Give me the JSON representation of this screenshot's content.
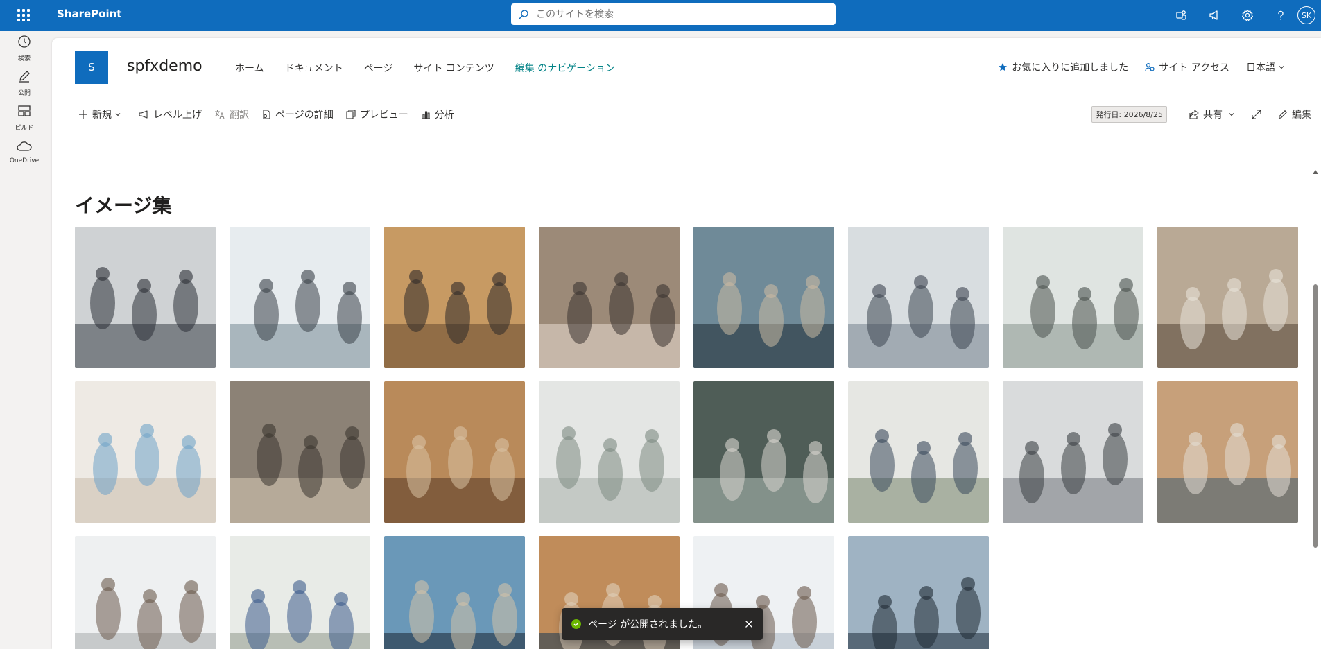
{
  "suite_bar": {
    "app_name": "SharePoint",
    "search_placeholder": "このサイトを検索",
    "user_initials": "SK",
    "icons": [
      "waffle-icon",
      "teams-icon",
      "megaphone-icon",
      "gear-icon",
      "help-icon"
    ]
  },
  "app_bar": {
    "items": [
      {
        "label": "検索",
        "icon": "search-icon"
      },
      {
        "label": "公開",
        "icon": "pen-icon"
      },
      {
        "label": "ビルド",
        "icon": "build-icon"
      },
      {
        "label": "OneDrive",
        "icon": "cloud-icon"
      }
    ]
  },
  "site": {
    "logo_letter": "S",
    "title": "spfxdemo",
    "nav": [
      "ホーム",
      "ドキュメント",
      "ページ",
      "サイト コンテンツ",
      "編集 のナビゲーション"
    ],
    "favorite": "お気に入りに追加しました",
    "site_access": "サイト アクセス",
    "language": "日本語"
  },
  "command_bar": {
    "new": "新規",
    "promote": "レベル上げ",
    "translate": "翻訳",
    "page_details": "ページの詳細",
    "preview": "プレビュー",
    "analytics": "分析",
    "published_date": "発行日: 2026/8/25",
    "share": "共有",
    "edit": "編集"
  },
  "content": {
    "section_title": "イメージ集",
    "gallery_count": 22
  },
  "toast": {
    "message": "ページ が公開されました。"
  },
  "colors": {
    "brand": "#0f6cbd",
    "nav_accent": "#038387",
    "toast_bg": "#292827",
    "success": "#6bb700"
  }
}
